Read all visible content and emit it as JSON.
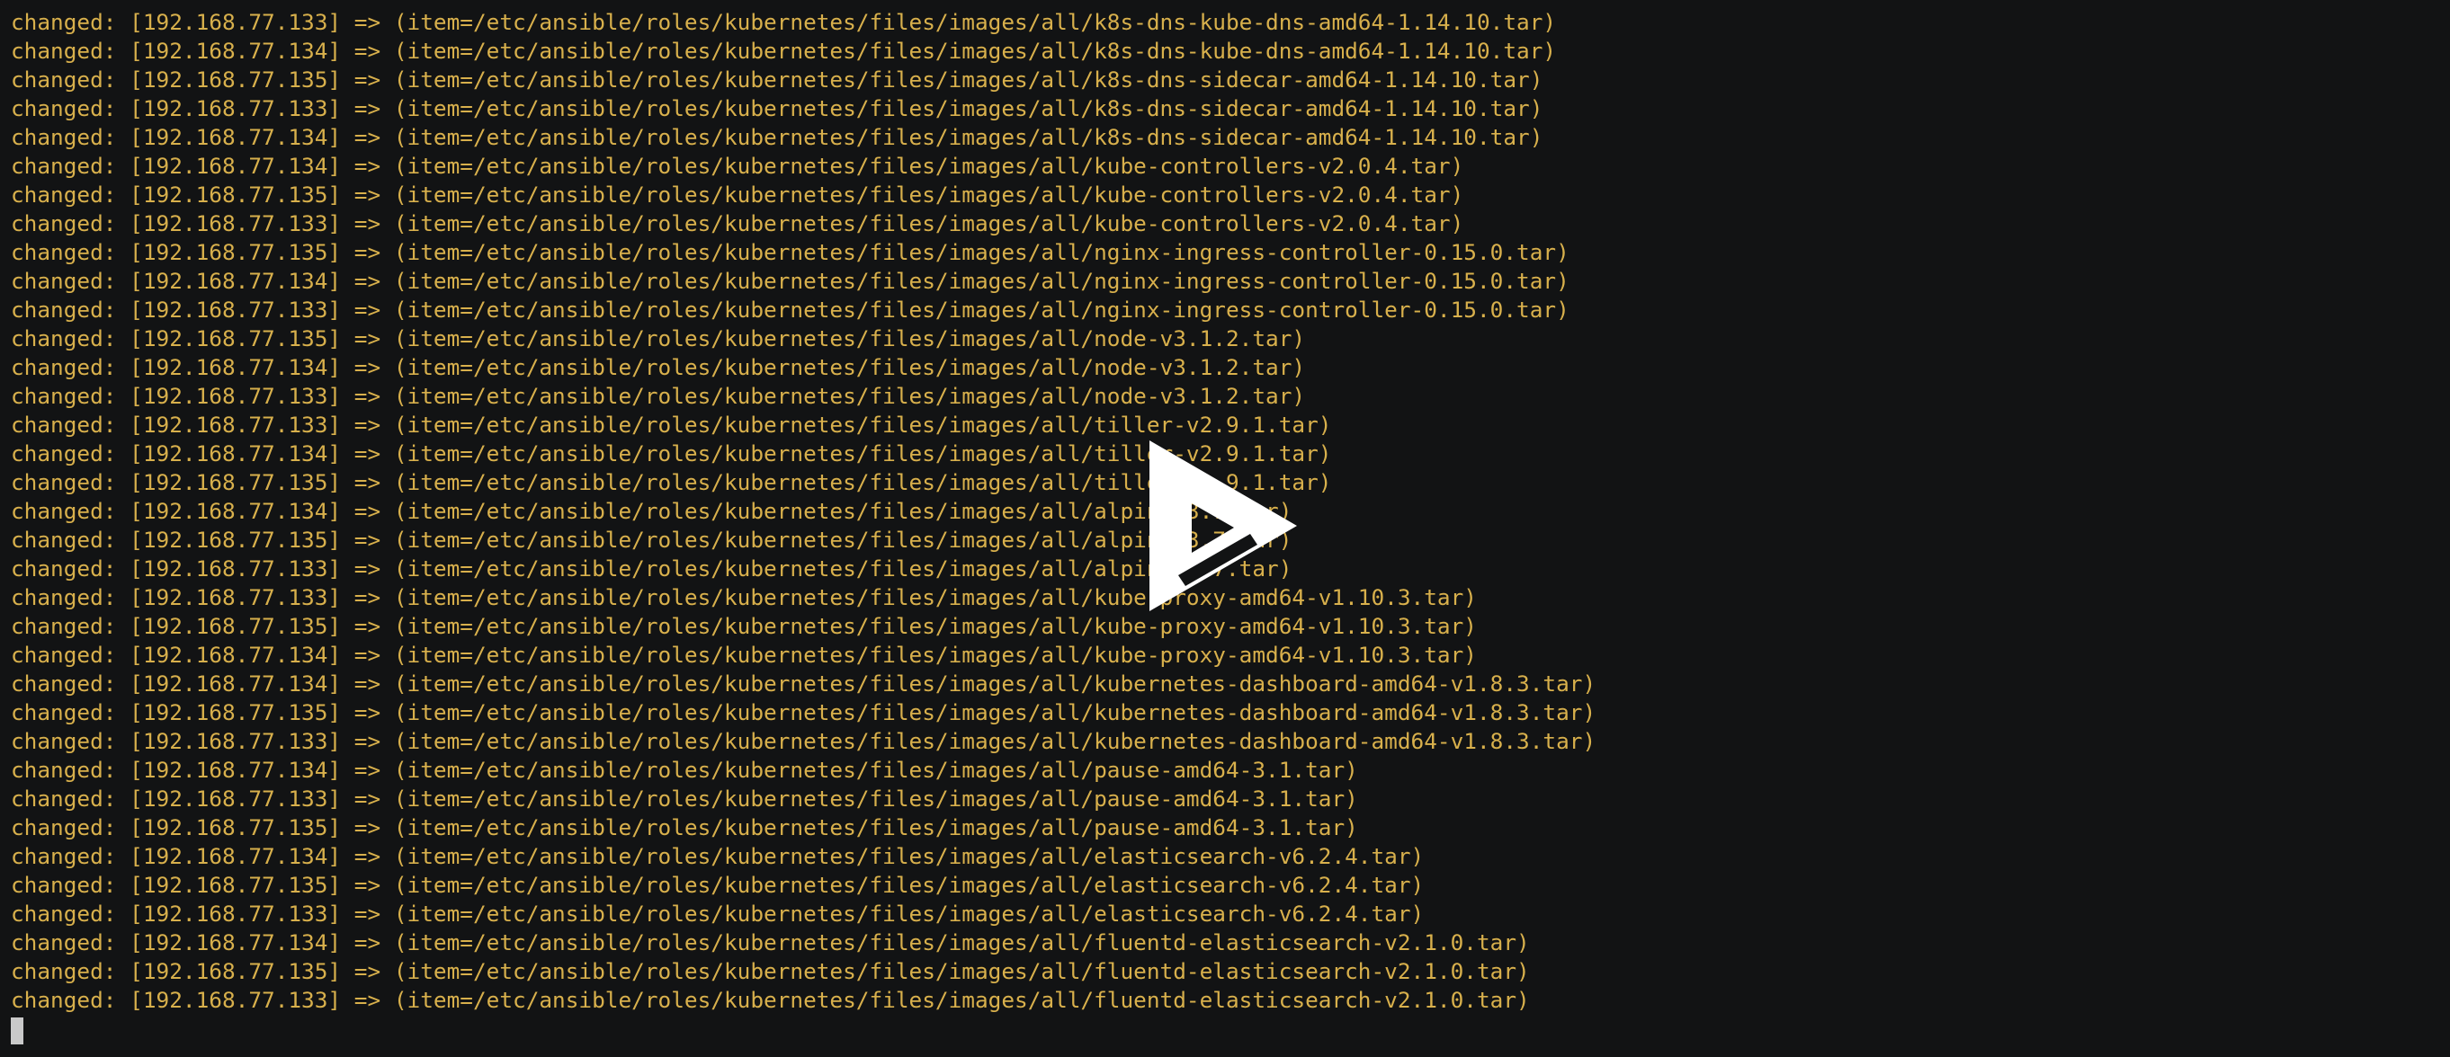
{
  "terminal": {
    "lines": [
      "changed: [192.168.77.133] => (item=/etc/ansible/roles/kubernetes/files/images/all/k8s-dns-kube-dns-amd64-1.14.10.tar)",
      "changed: [192.168.77.134] => (item=/etc/ansible/roles/kubernetes/files/images/all/k8s-dns-kube-dns-amd64-1.14.10.tar)",
      "changed: [192.168.77.135] => (item=/etc/ansible/roles/kubernetes/files/images/all/k8s-dns-sidecar-amd64-1.14.10.tar)",
      "changed: [192.168.77.133] => (item=/etc/ansible/roles/kubernetes/files/images/all/k8s-dns-sidecar-amd64-1.14.10.tar)",
      "changed: [192.168.77.134] => (item=/etc/ansible/roles/kubernetes/files/images/all/k8s-dns-sidecar-amd64-1.14.10.tar)",
      "changed: [192.168.77.134] => (item=/etc/ansible/roles/kubernetes/files/images/all/kube-controllers-v2.0.4.tar)",
      "changed: [192.168.77.135] => (item=/etc/ansible/roles/kubernetes/files/images/all/kube-controllers-v2.0.4.tar)",
      "changed: [192.168.77.133] => (item=/etc/ansible/roles/kubernetes/files/images/all/kube-controllers-v2.0.4.tar)",
      "changed: [192.168.77.135] => (item=/etc/ansible/roles/kubernetes/files/images/all/nginx-ingress-controller-0.15.0.tar)",
      "changed: [192.168.77.134] => (item=/etc/ansible/roles/kubernetes/files/images/all/nginx-ingress-controller-0.15.0.tar)",
      "changed: [192.168.77.133] => (item=/etc/ansible/roles/kubernetes/files/images/all/nginx-ingress-controller-0.15.0.tar)",
      "changed: [192.168.77.135] => (item=/etc/ansible/roles/kubernetes/files/images/all/node-v3.1.2.tar)",
      "changed: [192.168.77.134] => (item=/etc/ansible/roles/kubernetes/files/images/all/node-v3.1.2.tar)",
      "changed: [192.168.77.133] => (item=/etc/ansible/roles/kubernetes/files/images/all/node-v3.1.2.tar)",
      "changed: [192.168.77.133] => (item=/etc/ansible/roles/kubernetes/files/images/all/tiller-v2.9.1.tar)",
      "changed: [192.168.77.134] => (item=/etc/ansible/roles/kubernetes/files/images/all/tiller-v2.9.1.tar)",
      "changed: [192.168.77.135] => (item=/etc/ansible/roles/kubernetes/files/images/all/tiller-v2.9.1.tar)",
      "changed: [192.168.77.134] => (item=/etc/ansible/roles/kubernetes/files/images/all/alpine-3.7.tar)",
      "changed: [192.168.77.135] => (item=/etc/ansible/roles/kubernetes/files/images/all/alpine-3.7.tar)",
      "changed: [192.168.77.133] => (item=/etc/ansible/roles/kubernetes/files/images/all/alpine-3.7.tar)",
      "changed: [192.168.77.133] => (item=/etc/ansible/roles/kubernetes/files/images/all/kube-proxy-amd64-v1.10.3.tar)",
      "changed: [192.168.77.135] => (item=/etc/ansible/roles/kubernetes/files/images/all/kube-proxy-amd64-v1.10.3.tar)",
      "changed: [192.168.77.134] => (item=/etc/ansible/roles/kubernetes/files/images/all/kube-proxy-amd64-v1.10.3.tar)",
      "changed: [192.168.77.134] => (item=/etc/ansible/roles/kubernetes/files/images/all/kubernetes-dashboard-amd64-v1.8.3.tar)",
      "changed: [192.168.77.135] => (item=/etc/ansible/roles/kubernetes/files/images/all/kubernetes-dashboard-amd64-v1.8.3.tar)",
      "changed: [192.168.77.133] => (item=/etc/ansible/roles/kubernetes/files/images/all/kubernetes-dashboard-amd64-v1.8.3.tar)",
      "changed: [192.168.77.134] => (item=/etc/ansible/roles/kubernetes/files/images/all/pause-amd64-3.1.tar)",
      "changed: [192.168.77.133] => (item=/etc/ansible/roles/kubernetes/files/images/all/pause-amd64-3.1.tar)",
      "changed: [192.168.77.135] => (item=/etc/ansible/roles/kubernetes/files/images/all/pause-amd64-3.1.tar)",
      "changed: [192.168.77.134] => (item=/etc/ansible/roles/kubernetes/files/images/all/elasticsearch-v6.2.4.tar)",
      "changed: [192.168.77.135] => (item=/etc/ansible/roles/kubernetes/files/images/all/elasticsearch-v6.2.4.tar)",
      "changed: [192.168.77.133] => (item=/etc/ansible/roles/kubernetes/files/images/all/elasticsearch-v6.2.4.tar)",
      "changed: [192.168.77.134] => (item=/etc/ansible/roles/kubernetes/files/images/all/fluentd-elasticsearch-v2.1.0.tar)",
      "changed: [192.168.77.135] => (item=/etc/ansible/roles/kubernetes/files/images/all/fluentd-elasticsearch-v2.1.0.tar)",
      "changed: [192.168.77.133] => (item=/etc/ansible/roles/kubernetes/files/images/all/fluentd-elasticsearch-v2.1.0.tar)"
    ]
  },
  "overlay": {
    "icon": "play-icon"
  },
  "colors": {
    "background": "#121314",
    "text": "#d8b04c",
    "cursor": "#c9c9c9",
    "overlay": "#ffffff"
  }
}
